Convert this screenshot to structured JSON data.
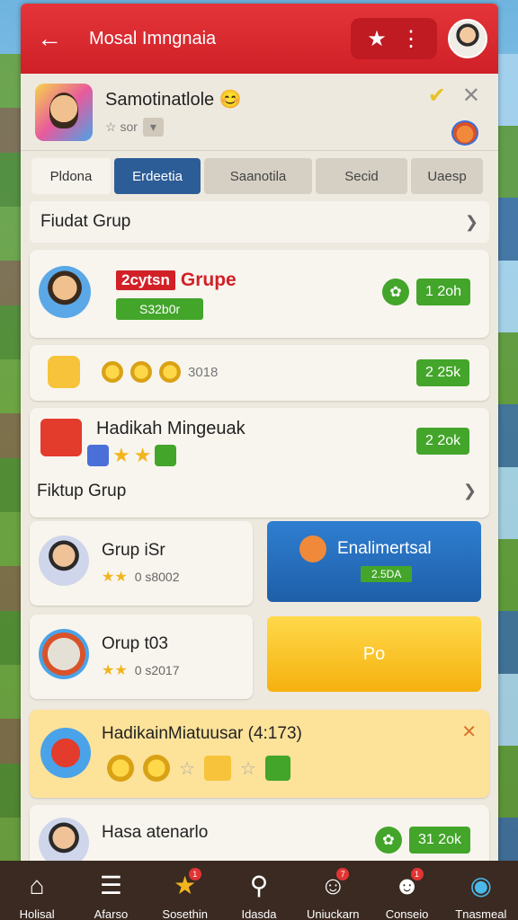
{
  "header": {
    "title": "Mosal Imngnaia",
    "back_icon": "←",
    "star_icon": "★",
    "more_icon": "⋮"
  },
  "profile": {
    "name": "Samotinatlole 😊",
    "rating_text": "☆ sor",
    "dropdown_icon": "▾",
    "check_icon": "✔",
    "close_icon": "✕"
  },
  "tabs": [
    "Pldona",
    "Erdeetia",
    "Saanotila",
    "Secid",
    "Uaesp"
  ],
  "sections": {
    "first": "Fiudat Grup",
    "second": "Fiktup Grup",
    "chevron": "❯"
  },
  "cards": {
    "grupe": {
      "boxed": "2cytsn",
      "label": "Grupe",
      "sub": "S32b0r",
      "value": "1 2oh"
    },
    "coins": {
      "count": "3018",
      "value": "2 25k"
    },
    "hadikah": {
      "title": "Hadikah Mingeuak",
      "value": "2 2ok"
    },
    "grup1": {
      "title": "Grup iSr",
      "value": "0 s8002"
    },
    "grup2": {
      "title": "Orup t03",
      "value": "0 s2017"
    },
    "enable": {
      "title": "Enalimertsal",
      "badge": "2.5DA"
    },
    "yellow": {
      "label": "Po"
    },
    "hadikain": {
      "title": "HadikainMiatuusar (4:173)",
      "close_icon": "✕"
    },
    "hasa": {
      "title": "Hasa atenarlo",
      "value": "31 2ok"
    }
  },
  "nav": [
    {
      "icon": "⌂",
      "label": "Holisal",
      "badge": ""
    },
    {
      "icon": "☰",
      "label": "Afarso",
      "badge": ""
    },
    {
      "icon": "★",
      "label": "Sosethin",
      "badge": "1"
    },
    {
      "icon": "⚲",
      "label": "Idasda",
      "badge": ""
    },
    {
      "icon": "☺",
      "label": "Uniuckarn",
      "badge": "7"
    },
    {
      "icon": "☻",
      "label": "Conseio",
      "badge": "1"
    },
    {
      "icon": "◉",
      "label": "Tnasmeal",
      "badge": ""
    }
  ],
  "colors": {
    "red": "#d22027",
    "blue": "#2c5d97",
    "green": "#43a52a",
    "yellow": "#f5b10e"
  }
}
